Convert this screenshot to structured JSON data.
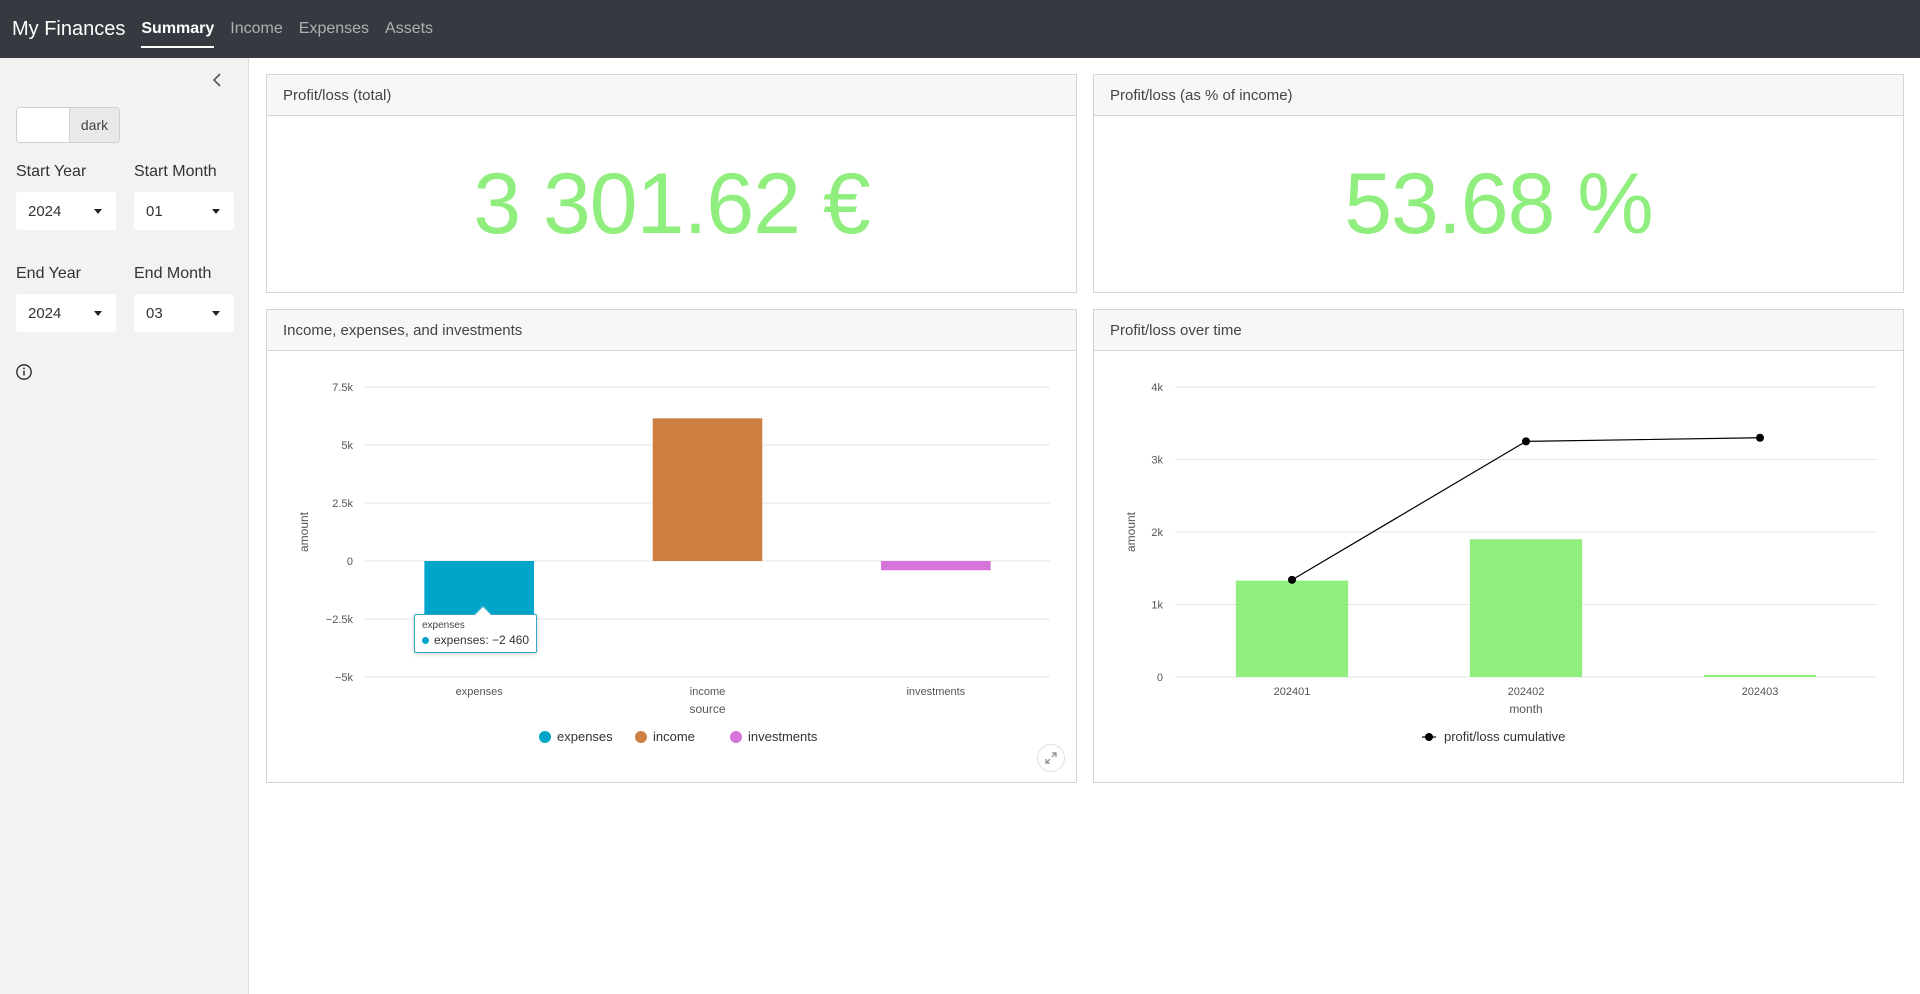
{
  "navbar": {
    "brand": "My Finances",
    "tabs": [
      "Summary",
      "Income",
      "Expenses",
      "Assets"
    ],
    "active_tab": "Summary"
  },
  "sidebar": {
    "dark_mode_label": "dark",
    "start_year_label": "Start Year",
    "start_year_value": "2024",
    "start_month_label": "Start Month",
    "start_month_value": "01",
    "end_year_label": "End Year",
    "end_year_value": "2024",
    "end_month_label": "End Month",
    "end_month_value": "03"
  },
  "cards": {
    "profit_total": {
      "title": "Profit/loss (total)",
      "value": "3 301.62 €"
    },
    "profit_pct": {
      "title": "Profit/loss (as % of income)",
      "value": "53.68 %"
    },
    "income_chart": {
      "title": "Income, expenses, and investments"
    },
    "time_chart": {
      "title": "Profit/loss over time"
    }
  },
  "tooltip": {
    "title": "expenses",
    "label": "expenses:",
    "value": "−2 460"
  },
  "colors": {
    "value_green": "#90ee7e",
    "expenses": "#00a6ca",
    "income": "#cd8042",
    "investments": "#d675d9",
    "bar_green": "#90ee7e",
    "line": "#000000"
  },
  "chart_data": [
    {
      "type": "bar",
      "categories": [
        "expenses",
        "income",
        "investments"
      ],
      "values": [
        -2460,
        6150,
        -400
      ],
      "colors": [
        "#00a6ca",
        "#cd8042",
        "#d675d9"
      ],
      "xlabel": "source",
      "ylabel": "amount",
      "ylim": [
        -5000,
        7500
      ],
      "yticks": [
        7500,
        5000,
        2500,
        0,
        -2500,
        -5000
      ],
      "ytick_labels": [
        "7.5k",
        "5k",
        "2.5k",
        "0",
        "−2.5k",
        "−5k"
      ],
      "legend": [
        "expenses",
        "income",
        "investments"
      ],
      "legend_position": "bottom",
      "grid": true
    },
    {
      "type": "bar",
      "categories": [
        "202401",
        "202402",
        "202403"
      ],
      "series": [
        {
          "values": [
            1330,
            1900,
            30
          ],
          "color": "#90ee7e"
        },
        {
          "name": "profit/loss cumulative",
          "type": "line",
          "values": [
            1340,
            3250,
            3300
          ],
          "color": "#000000"
        }
      ],
      "xlabel": "month",
      "ylabel": "amount",
      "ylim": [
        0,
        4000
      ],
      "yticks": [
        4000,
        3000,
        2000,
        1000,
        0
      ],
      "ytick_labels": [
        "4k",
        "3k",
        "2k",
        "1k",
        "0"
      ],
      "legend": [
        "profit/loss cumulative"
      ],
      "legend_position": "bottom",
      "grid": true
    }
  ]
}
